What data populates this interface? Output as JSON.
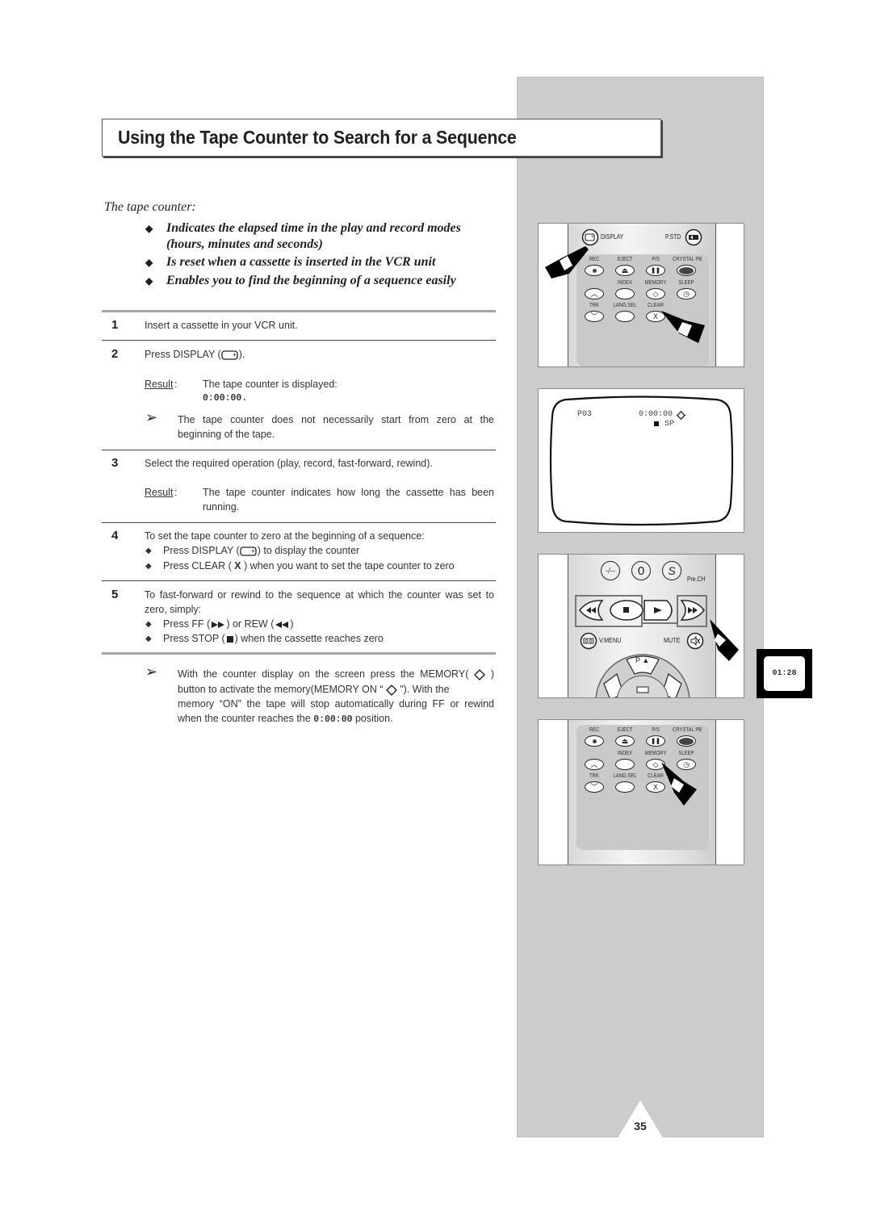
{
  "page": {
    "title": "Using the Tape Counter to Search for a Sequence",
    "page_number": "35",
    "clock": "01:28"
  },
  "intro": {
    "heading": "The tape counter:",
    "bullets": [
      "Indicates the elapsed time in the play and record modes",
      "(hours, minutes and seconds)",
      "Is reset when a cassette is inserted in the VCR unit",
      "Enables you to find the beginning of a sequence easily"
    ]
  },
  "steps": [
    {
      "num": "1",
      "text": "Insert a cassette in your VCR unit."
    },
    {
      "num": "2",
      "text_pre": "Press DISPLAY (",
      "text_post": ").",
      "result_label": "Result",
      "result_text": "The tape counter is displayed:",
      "result_value": "0:00:00",
      "note_line1": "The tape counter does not necessarily start from zero at the",
      "note_line2": "beginning of the tape."
    },
    {
      "num": "3",
      "text": "Select the required operation (play, record, fast-forward, rewind).",
      "result_label": "Result",
      "result_line1": "The tape counter indicates how long the cassette has been",
      "result_line2": "running."
    },
    {
      "num": "4",
      "text": "To set the tape counter to zero at the beginning of a sequence:",
      "bullet1_pre": "Press DISPLAY (",
      "bullet1_post": ") to display the counter",
      "bullet2_pre": "Press CLEAR (",
      "bullet2_icon": "X",
      "bullet2_post": ") when you want to set the tape counter to zero"
    },
    {
      "num": "5",
      "line1": "To fast-forward or rewind to the sequence at which the counter was set to",
      "line2": "zero, simply:",
      "bullet1_pre": "Press FF (",
      "bullet1_mid": ") or REW (",
      "bullet1_post": ")",
      "bullet2_pre": "Press STOP (",
      "bullet2_post": ") when the cassette reaches zero"
    }
  ],
  "final_note": {
    "line1_pre": "With the counter display on the screen press the MEMORY(",
    "line1_post": ")",
    "line2_pre": "button to activate the memory(MEMORY ON “",
    "line2_post": "”). With the",
    "line3": "memory “ON” the tape will stop automatically during FF or rewind",
    "line4_pre": "when the counter reaches the",
    "line4_value": "0:00:00",
    "line4_post": "position."
  },
  "remote_top": {
    "display_label": "DISPLAY",
    "pstd_label": "P.STD",
    "row1": [
      "REC",
      "EJECT",
      "P/S",
      "CRYSTAL PB"
    ],
    "row2": [
      "INDEX",
      "MEMORY",
      "SLEEP"
    ],
    "row3": [
      "TRK",
      "LANG.SEL",
      "CLEAR"
    ],
    "clear_glyph": "X"
  },
  "tv_screen": {
    "channel": "P03",
    "counter": "0:00:00",
    "mode": "SP"
  },
  "remote_middle": {
    "btn_dash": "-/--",
    "btn_zero": "0",
    "btn_prech": "Pre.CH",
    "vmenu_label": "V.MENU",
    "mute_label": "MUTE",
    "p_up_label": "P ▲"
  },
  "remote_bottom": {
    "row1": [
      "REC",
      "EJECT",
      "P/S",
      "CRYSTAL PB"
    ],
    "row2": [
      "INDEX",
      "MEMORY",
      "SLEEP"
    ],
    "row3": [
      "TRK",
      "LANG.SEL",
      "CLEAR"
    ],
    "clear_glyph": "X"
  }
}
